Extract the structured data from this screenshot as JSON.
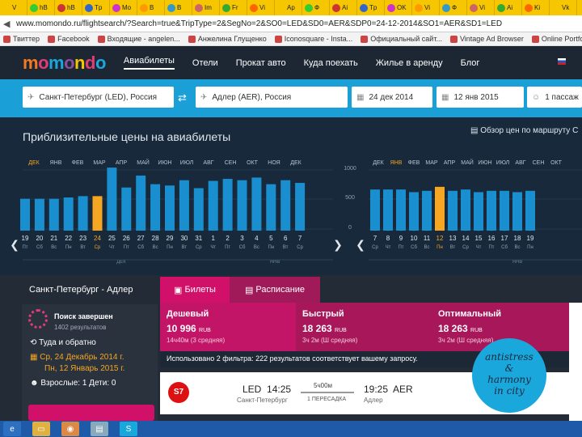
{
  "browser": {
    "tabs": [
      "V",
      "hB",
      "hB",
      "Tp",
      "Mo",
      "B",
      "B",
      "Im",
      "Fr",
      "Vi",
      "Ap",
      "Ф",
      "Ai",
      "Tp",
      "OK",
      "Vi",
      "Ф",
      "Vi",
      "Ai",
      "Ki",
      "Vk"
    ],
    "url": "www.momondo.ru/flightsearch/?Search=true&TripType=2&SegNo=2&SO0=LED&SD0=AER&SDP0=24-12-2014&SO1=AER&SD1=LED",
    "bookmarks": [
      "Твиттер",
      "Facebook",
      "Входящие - angelen...",
      "Анжелина Глущенко",
      "Iconosquare - Insta...",
      "Официальный сайт...",
      "Vintage Ad Browser",
      "Online Portfo"
    ]
  },
  "header": {
    "logo": "momondo",
    "logo_colors": [
      "#f47a20",
      "#e23c77",
      "#1aa7db",
      "#8a4f9e",
      "#f6c700",
      "#e23c77",
      "#1aa7db"
    ],
    "nav": [
      "Авиабилеты",
      "Отели",
      "Прокат авто",
      "Куда поехать",
      "Жилье в аренду",
      "Блог"
    ]
  },
  "search": {
    "origin": "Санкт-Петербург (LED), Россия",
    "destination": "Адлер (AER), Россия",
    "depart": "24 дек 2014",
    "return": "12 янв 2015",
    "passengers": "1 пассаж"
  },
  "prices": {
    "title": "Приблизительные цены на авиабилеты",
    "overview": "Обзор цен по маршруту С",
    "yticks": [
      "1000",
      "500",
      "0"
    ],
    "left_months": [
      "ДЕК",
      "ЯНВ",
      "ФЕВ",
      "МАР",
      "АПР",
      "МАЙ",
      "ИЮН",
      "ИЮЛ",
      "АВГ",
      "СЕН",
      "ОКТ",
      "НОЯ",
      "ДЕК"
    ],
    "right_months": [
      "ДЕК",
      "ЯНВ",
      "ФЕВ",
      "МАР",
      "АПР",
      "МАЙ",
      "ИЮН",
      "ИЮЛ",
      "АВГ",
      "СЕН",
      "ОКТ"
    ],
    "left_days": [
      "19",
      "20",
      "21",
      "22",
      "23",
      "24",
      "25",
      "26",
      "27",
      "28",
      "29",
      "30",
      "31",
      "1",
      "2",
      "3",
      "4",
      "5",
      "6",
      "7"
    ],
    "left_weekdays": [
      "Пт",
      "Сб",
      "Вс",
      "Пн",
      "Вт",
      "Ср",
      "Чт",
      "Пт",
      "Сб",
      "Вс",
      "Пн",
      "Вт",
      "Ср",
      "Чт",
      "Пт",
      "Сб",
      "Вс",
      "Пн",
      "Вт",
      "Ср"
    ],
    "right_days": [
      "7",
      "8",
      "9",
      "10",
      "11",
      "12",
      "13",
      "14",
      "15",
      "16",
      "17",
      "18",
      "19"
    ],
    "right_weekdays": [
      "Ср",
      "Чт",
      "Пт",
      "Сб",
      "Вс",
      "Пн",
      "Вт",
      "Ср",
      "Чт",
      "Пт",
      "Сб",
      "Вс",
      "Пн"
    ],
    "left_group_labels": [
      "ДЕК",
      "ЯНВ"
    ],
    "right_group_label": "ЯНВ"
  },
  "chart_data": [
    {
      "type": "bar",
      "categories": [
        "19",
        "20",
        "21",
        "22",
        "23",
        "24",
        "25",
        "26",
        "27",
        "28",
        "29",
        "30",
        "31",
        "1",
        "2",
        "3",
        "4",
        "5",
        "6",
        "7"
      ],
      "values": [
        480,
        480,
        480,
        500,
        520,
        520,
        950,
        650,
        830,
        700,
        680,
        760,
        640,
        750,
        780,
        760,
        800,
        700,
        760,
        720
      ],
      "highlighted": "24",
      "ylim": [
        0,
        1000
      ],
      "yticks": [
        "1000",
        "500",
        "0"
      ],
      "colors": {
        "bar": "#1a8fd0",
        "highlight": "#f5a623"
      }
    },
    {
      "type": "bar",
      "categories": [
        "7",
        "8",
        "9",
        "10",
        "11",
        "12",
        "13",
        "14",
        "15",
        "16",
        "17",
        "18",
        "19"
      ],
      "values": [
        620,
        620,
        620,
        580,
        600,
        660,
        600,
        620,
        580,
        600,
        600,
        580,
        600
      ],
      "highlighted": "12",
      "ylim": [
        0,
        1000
      ],
      "colors": {
        "bar": "#1a8fd0",
        "highlight": "#f5a623"
      }
    }
  ],
  "results": {
    "route_title": "Санкт-Петербург - Адлер",
    "search_status": "Поиск завершен",
    "search_results": "1402 результатов",
    "trip_type": "Туда и обратно",
    "date_out": "Ср, 24 Декабрь 2014 г.",
    "date_back": "Пн, 12 Январь 2015 г.",
    "pax": "Взрослые: 1 Дети: 0",
    "tab_tickets": "Билеты",
    "tab_schedule": "Расписание",
    "cards": [
      {
        "title": "Дешевый",
        "price": "10 996",
        "currency": "RUB",
        "sub": "14ч40м (3 средняя)"
      },
      {
        "title": "Быстрый",
        "price": "18 263",
        "currency": "RUB",
        "sub": "3ч 2м (Ш средняя)"
      },
      {
        "title": "Оптимальный",
        "price": "18 263",
        "currency": "RUB",
        "sub": "3ч 2м (Ш средняя)"
      }
    ],
    "filter_text": "Использовано 2 фильтра: 222 результатов соответствует вашему запросу.",
    "flight": {
      "from_code": "LED",
      "dep_time": "14:25",
      "from_city": "Санкт-Петербург",
      "duration": "5ч00м",
      "stops": "1 ПЕРЕСАДКА",
      "to_code": "AER",
      "arr_time": "19:25",
      "to_city": "Адлер",
      "airline_logo": "S7"
    }
  },
  "badge": {
    "line1": "antistress",
    "line2": "&",
    "line3": "harmony",
    "line4": "in city"
  }
}
